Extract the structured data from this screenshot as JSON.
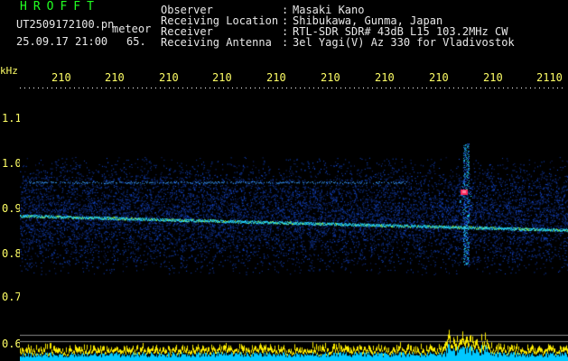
{
  "header": {
    "logo": "HROFFT",
    "filename": "UT2509172100.pn",
    "meteor_label": "meteor",
    "datetime": "25.09.17 21:00",
    "value": "65."
  },
  "meta": [
    {
      "key": "Observer",
      "sep": ":",
      "value": "Masaki Kano"
    },
    {
      "key": "Receiving Location",
      "sep": ":",
      "value": "Shibukawa, Gunma, Japan"
    },
    {
      "key": "Receiver",
      "sep": ":",
      "value": "RTL-SDR SDR# 43dB L15 103.2MHz CW"
    },
    {
      "key": "Receiving Antenna",
      "sep": ":",
      "value": "3el Yagi(V) Az 330 for Vladivostok"
    }
  ],
  "spectrogram": {
    "unit": "kHz",
    "time_ticks": [
      "210",
      "210",
      "210",
      "210",
      "210",
      "210",
      "210",
      "210",
      "210",
      "2110"
    ],
    "freq_ticks": [
      "1.1",
      "1.0",
      "0.9",
      "0.8",
      "0.7",
      "0.6"
    ],
    "colors": {
      "background": "#000000",
      "noise": "#1e46ff",
      "signal": "#22e0ff",
      "peak": "#ff2a5a",
      "bottom_bar": "#00c8ff",
      "bottom_peak": "#ffee00"
    }
  }
}
